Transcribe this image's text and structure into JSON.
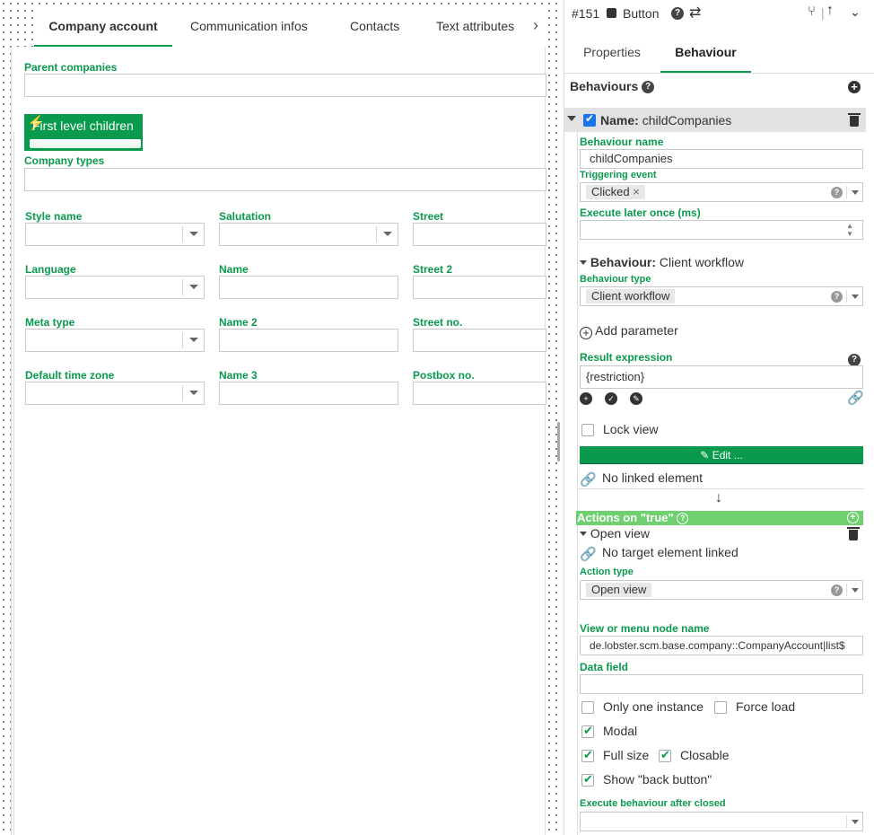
{
  "canvas": {
    "tabs": [
      {
        "label": "Company account"
      },
      {
        "label": "Communication infos"
      },
      {
        "label": "Contacts"
      },
      {
        "label": "Text attributes"
      }
    ],
    "parent_companies_label": "Parent companies",
    "button_label": "First level children",
    "company_types_label": "Company types",
    "fields": [
      {
        "label": "Style name"
      },
      {
        "label": "Salutation"
      },
      {
        "label": "Street"
      },
      {
        "label": "Language"
      },
      {
        "label": "Name"
      },
      {
        "label": "Street 2"
      },
      {
        "label": "Meta type"
      },
      {
        "label": "Name 2"
      },
      {
        "label": "Street no."
      },
      {
        "label": "Default time zone"
      },
      {
        "label": "Name 3"
      },
      {
        "label": "Postbox no."
      }
    ]
  },
  "panel": {
    "id": "#151",
    "element_type": "Button",
    "tabs": [
      {
        "label": "Properties"
      },
      {
        "label": "Behaviour"
      }
    ],
    "behaviours_title": "Behaviours",
    "name_prefix": "Name:",
    "name_value": "childCompanies",
    "behaviour_name_label": "Behaviour name",
    "behaviour_name_value": "childCompanies",
    "triggering_event_label": "Triggering event",
    "triggering_event_value": "Clicked",
    "execute_later_label": "Execute later once (ms)",
    "behaviour_prefix": "Behaviour:",
    "behaviour_value": "Client workflow",
    "behaviour_type_label": "Behaviour type",
    "behaviour_type_value": "Client workflow",
    "add_parameter_label": "Add parameter",
    "result_expression_label": "Result expression",
    "result_expression_value": "{restriction}",
    "lock_view_label": "Lock view",
    "edit_label": "Edit ...",
    "no_linked_label": "No linked element",
    "arrow": "↓",
    "actions_true_label": "Actions on \"true\"",
    "open_view_header": "Open view",
    "no_target_label": "No target element linked",
    "action_type_label": "Action type",
    "action_type_value": "Open view",
    "view_node_label": "View or menu node name",
    "view_node_value": "de.lobster.scm.base.company::CompanyAccount|list$",
    "data_field_label": "Data field",
    "only_one_label": "Only one instance",
    "force_load_label": "Force load",
    "modal_label": "Modal",
    "full_size_label": "Full size",
    "closable_label": "Closable",
    "back_button_label": "Show \"back button\"",
    "after_closed_label": "Execute behaviour after closed"
  },
  "colors": {
    "accent": "#0a9a4d",
    "true_bar": "#6fd06f"
  }
}
